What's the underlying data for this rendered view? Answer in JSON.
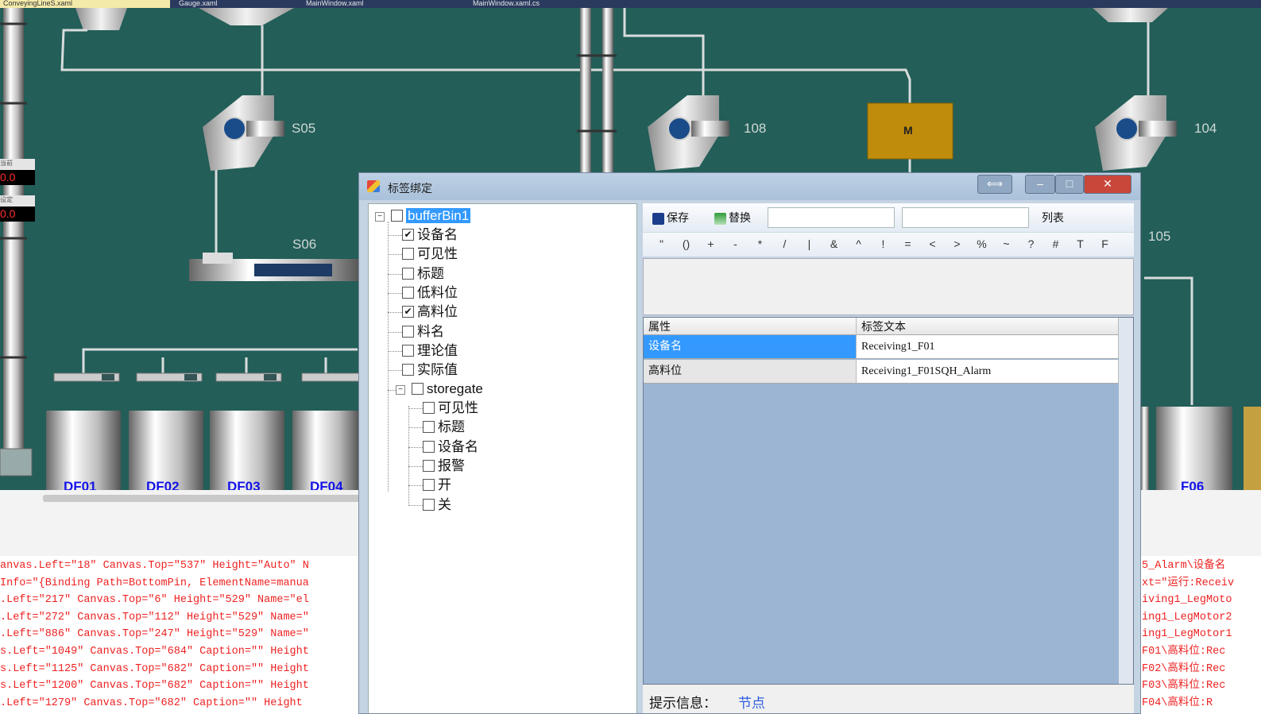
{
  "ide_tabs": [
    "ConveyingLineS.xaml",
    "Gauge.xaml",
    "MainWindow.xaml",
    "MainWindow.xaml.cs"
  ],
  "scada": {
    "equipment_labels": [
      "S05",
      "108",
      "104",
      "S06",
      "105"
    ],
    "motor_label": "M",
    "bin_labels": [
      "DF01",
      "DF02",
      "DF03",
      "DF04",
      "F06"
    ],
    "readouts": [
      {
        "caption": "当前",
        "value": "0.0"
      },
      {
        "caption": "设定",
        "value": "0.0"
      }
    ]
  },
  "code_left": [
    "anvas.Left=\"18\" Canvas.Top=\"537\" Height=\"Auto\" N",
    "Info=\"{Binding Path=BottomPin, ElementName=manua",
    ".Left=\"217\" Canvas.Top=\"6\" Height=\"529\" Name=\"el",
    ".Left=\"272\" Canvas.Top=\"112\" Height=\"529\" Name=\"",
    ".Left=\"886\" Canvas.Top=\"247\" Height=\"529\" Name=\"",
    "s.Left=\"1049\" Canvas.Top=\"684\" Caption=\"\" Height",
    "s.Left=\"1125\" Canvas.Top=\"682\" Caption=\"\" Height",
    "s.Left=\"1200\" Canvas.Top=\"682\" Caption=\"\" Height",
    ".Left=\"1279\" Canvas.Top=\"682\" Caption=\"\" Height"
  ],
  "code_right": [
    "5_Alarm\\设备名",
    "xt=\"运行:Receiv",
    "iving1_LegMoto",
    "ing1_LegMotor2",
    "ing1_LegMotor1",
    "F01\\高料位:Rec",
    "F02\\高料位:Rec",
    "F03\\高料位:Rec",
    "F04\\高料位:R"
  ],
  "dialog": {
    "title": "标签绑定",
    "tree": {
      "root": "bufferBin1",
      "children": [
        {
          "label": "设备名",
          "checked": true
        },
        {
          "label": "可见性",
          "checked": false
        },
        {
          "label": "标题",
          "checked": false
        },
        {
          "label": "低料位",
          "checked": false
        },
        {
          "label": "高料位",
          "checked": true
        },
        {
          "label": "料名",
          "checked": false
        },
        {
          "label": "理论值",
          "checked": false
        },
        {
          "label": "实际值",
          "checked": false
        }
      ],
      "sub": {
        "label": "storegate",
        "children": [
          "可见性",
          "标题",
          "设备名",
          "报警",
          "开",
          "关"
        ]
      }
    },
    "toolbar": {
      "save": "保存",
      "replace": "替换",
      "list": "列表",
      "input1": "",
      "input2": ""
    },
    "symbols": [
      "\"",
      "()",
      "+",
      "-",
      "*",
      "/",
      "|",
      "&",
      "^",
      "!",
      "=",
      "<",
      ">",
      "%",
      "~",
      "?",
      "#",
      "T",
      "F"
    ],
    "grid": {
      "headers": [
        "属性",
        "标签文本"
      ],
      "rows": [
        {
          "prop": "设备名",
          "tag": "Receiving1_F01"
        },
        {
          "prop": "高料位",
          "tag": "Receiving1_F01SQH_Alarm"
        }
      ]
    },
    "status": {
      "label": "提示信息：",
      "value": "节点"
    }
  }
}
